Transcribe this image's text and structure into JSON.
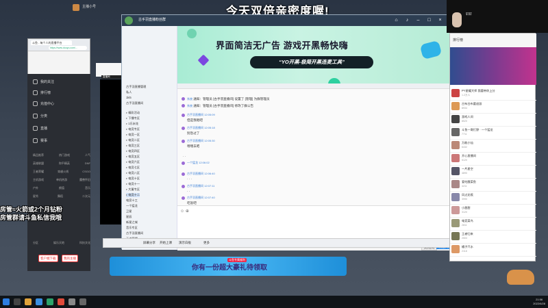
{
  "overlay": {
    "stream_title": "今天双倍亲密度喔!",
    "left_text_line1": "房管≈火箭或2个月钻粉",
    "left_text_line2": "房管群请斗鱼私信我哦"
  },
  "browser": {
    "tab_label": "斗鱼 - 每个人的直播平台",
    "url": "https://www.douyu.com/...",
    "nav_items": [
      "我的关注",
      "排行榜",
      "充值中心",
      "分类",
      "直播",
      "赛事"
    ],
    "grid_rows": [
      [
        "精品推荐",
        "热门游戏",
        "人气"
      ],
      [
        "英雄联盟",
        "和平精英",
        "DNF"
      ],
      [
        "王者荣耀",
        "穿越火线",
        "CSGO"
      ],
      [
        "主机游戏",
        "单机热游",
        "魔兽怀旧"
      ],
      [
        "户外",
        "颜值",
        "音乐"
      ],
      [
        "星秀",
        "舞蹈",
        "二次元"
      ],
      [
        "分区",
        "娱乐天地",
        "科技文化"
      ]
    ],
    "btn_left": "客户端下载",
    "btn_right": "我的主播"
  },
  "video_title": "直播间",
  "qq": {
    "title": "古手羽直播粉丝群",
    "group_list": [
      "古手羽直播管理",
      "私人",
      "1ki5",
      "古手羽直播间",
      "精彩活动",
      "下播专区",
      "1乐米花",
      "电竞专区",
      "电竞一区",
      "电竞二区",
      "电竞三区",
      "电竞四区",
      "电竞五区",
      "电竞六区",
      "电竞七区",
      "电竞八区",
      "电竞十区",
      "电竞十一",
      "大厦专区",
      "电竞十二",
      "电竞十三",
      "一个猛龙",
      "卫星",
      "星辰",
      "新星之城",
      "音乐专区",
      "古手羽直播间",
      "王者荣耀",
      "主播"
    ],
    "ad_title": "界面简洁无广告  游戏开黑畅快嗨",
    "ad_pill": "“YO开黑-极简开黑连麦工具”",
    "messages": [
      {
        "who": "系统",
        "text": "通知：管理员 [古手羽直播间] 设置了 [管理] 为群管理员"
      },
      {
        "who": "系统",
        "text": "通知：管理员 [古手羽直播间] 修改了群公告"
      },
      {
        "who": "古手羽直播间 12:05:09",
        "text": "但是我唱吧"
      },
      {
        "who": "古手羽直播间 12:05:18",
        "text": "别急过了"
      },
      {
        "who": "古手羽直播间 12:05:30",
        "text": "嘿嘿去吧"
      },
      {
        "who": "系统",
        "text": "·  ·"
      },
      {
        "who": "一个猛龙 12:06:02",
        "text": ""
      },
      {
        "who": "古手羽直播间 12:06:40",
        "text": "·  ·  ·"
      },
      {
        "who": "古手羽直播间 12:07:11",
        "text": "·  ·"
      },
      {
        "who": "古手羽直播间 12:07:40",
        "text": "吃饭吧"
      }
    ],
    "send_label": "发送(S)",
    "close_label": "关闭(C)"
  },
  "dock": {
    "items": [
      "屏幕分享",
      "开始上课",
      "演示白板",
      "更多"
    ]
  },
  "lower_banner": {
    "label": "斗鱼专属福利",
    "text": "你有一份超大豪礼待领取"
  },
  "right_pane": {
    "header": "排行榜",
    "list": [
      {
        "name": "PY星耀大师 我要带你上分",
        "sub": "1.2万人",
        "color": "#c44"
      },
      {
        "name": "吕布吕布要退游",
        "sub": "8934",
        "color": "#d95"
      },
      {
        "name": "游戏人间",
        "sub": "8520",
        "color": "#444"
      },
      {
        "name": "斗鱼一哥打野 · 一个猛龙",
        "sub": "7711",
        "color": "#666"
      },
      {
        "name": "万能小仙",
        "sub": "6432",
        "color": "#b87"
      },
      {
        "name": "开心直播间",
        "sub": "5120",
        "color": "#c77"
      },
      {
        "name": "一片星空",
        "sub": "4890",
        "color": "#556"
      },
      {
        "name": "爱吃酸菜鱼",
        "sub": "4211",
        "color": "#a88"
      },
      {
        "name": "风过无痕",
        "sub": "3990",
        "color": "#88a"
      },
      {
        "name": "小甜甜",
        "sub": "3120",
        "color": "#c99"
      },
      {
        "name": "电竞菜鸟",
        "sub": "2811",
        "color": "#997"
      },
      {
        "name": "王者归来",
        "sub": "2503",
        "color": "#775"
      },
      {
        "name": "橘子汽水",
        "sub": "2118",
        "color": "#d96"
      }
    ]
  },
  "cam": {
    "name": "轩轩"
  },
  "top_left": {
    "name": "主播小号"
  },
  "clock": {
    "time": "21:56",
    "date": "2022/6/28"
  }
}
